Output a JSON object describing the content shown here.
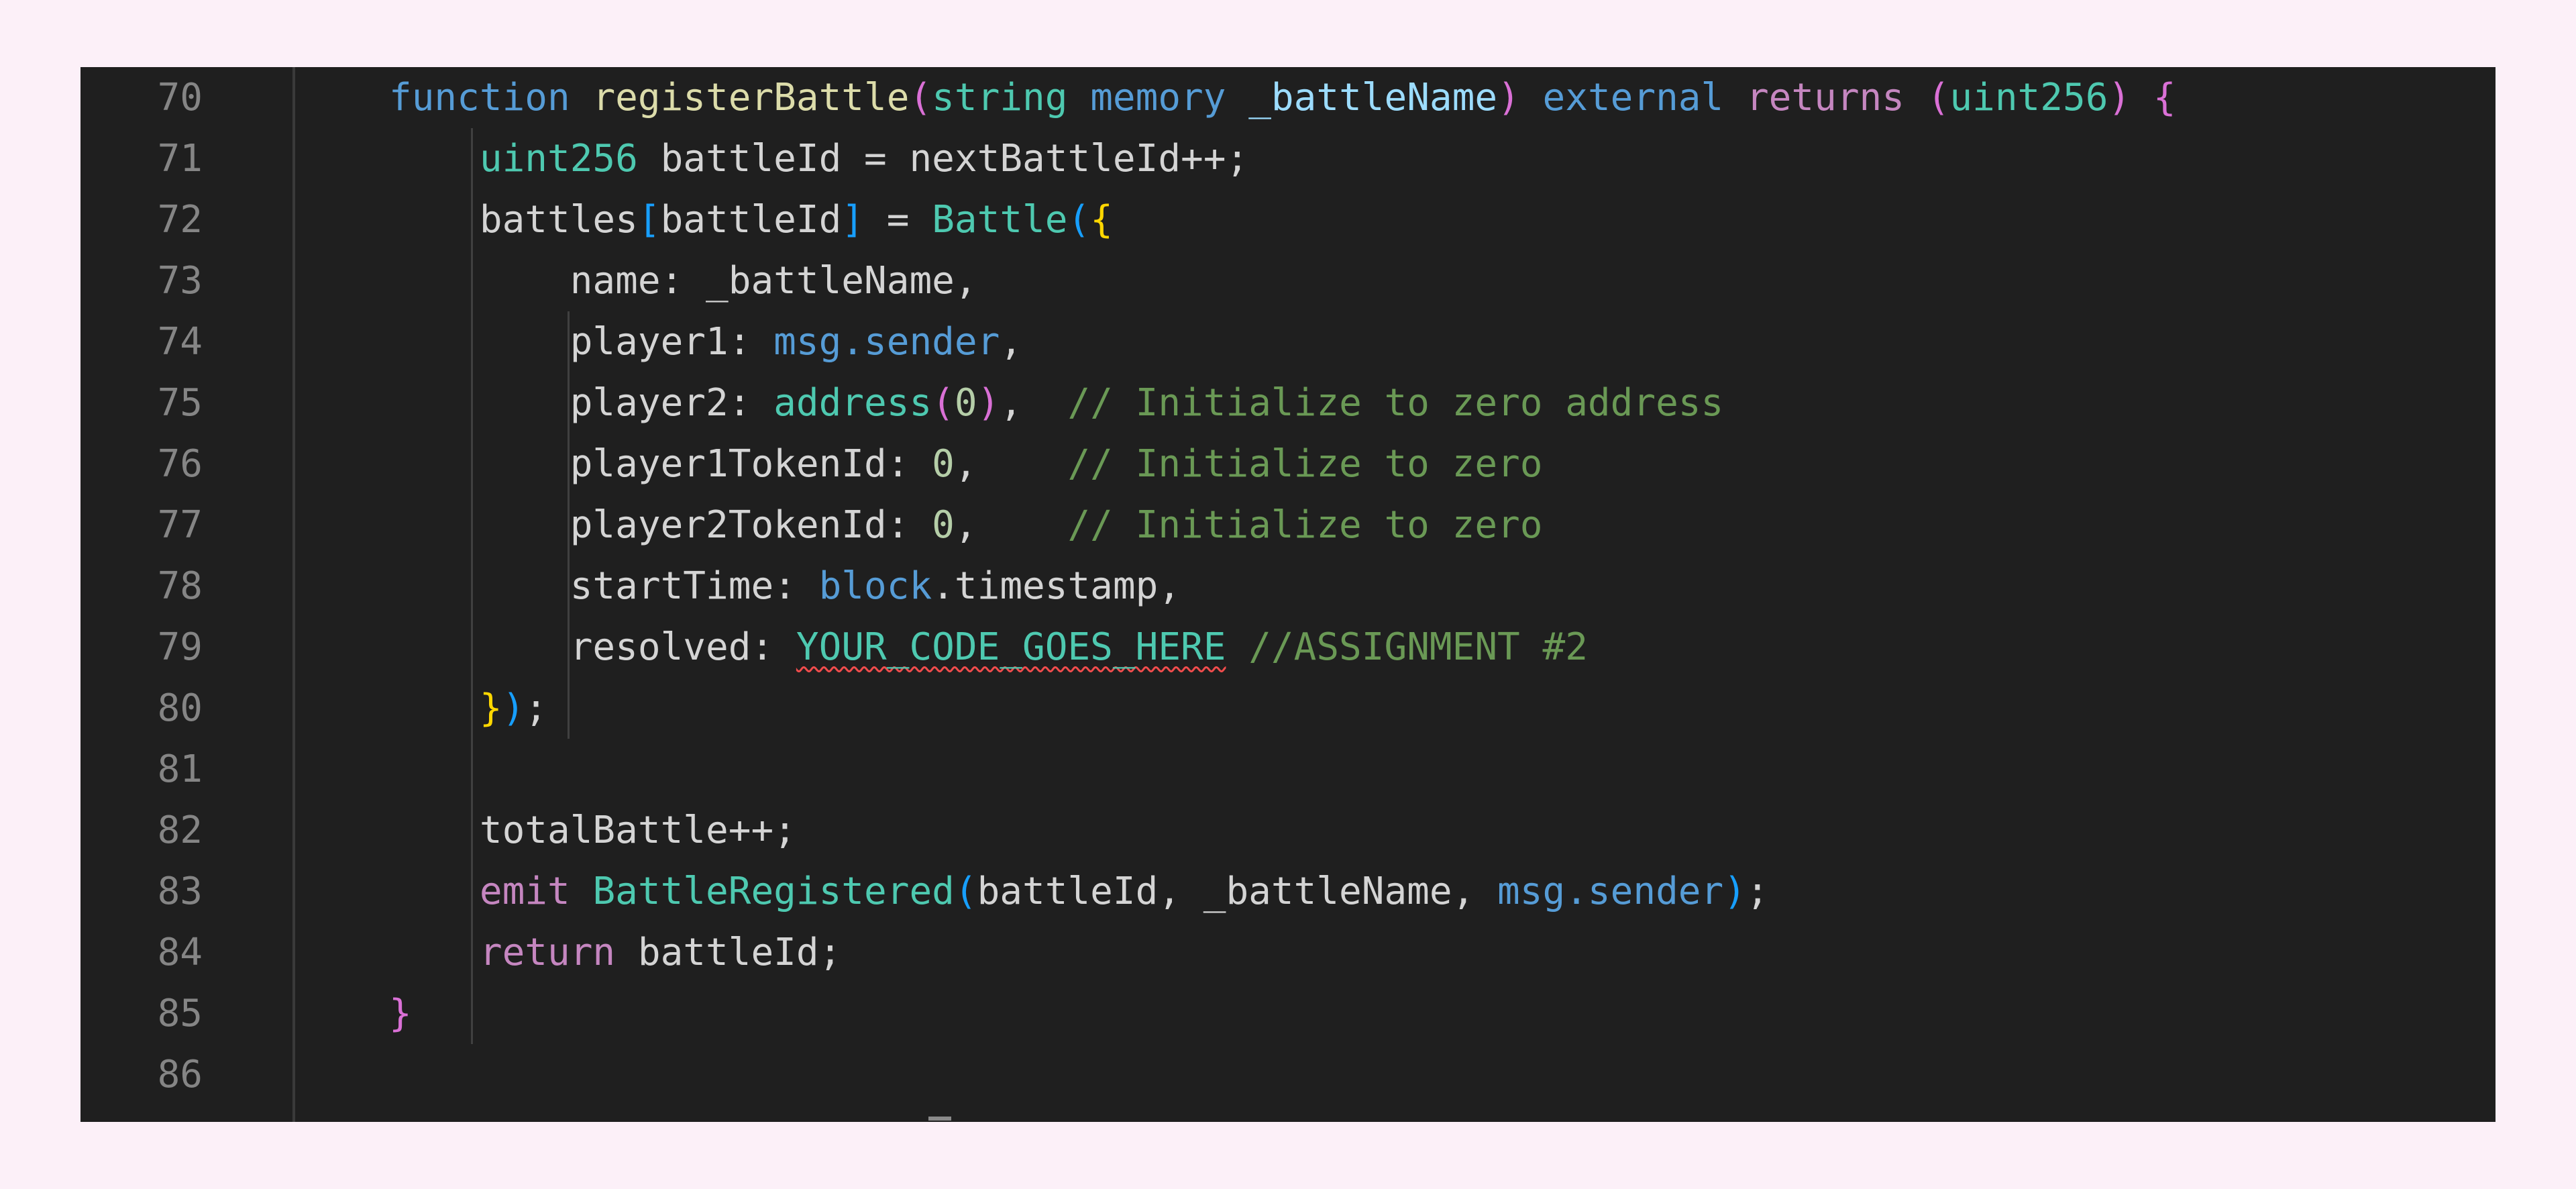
{
  "editor": {
    "line_numbers": [
      "70",
      "71",
      "72",
      "73",
      "74",
      "75",
      "76",
      "77",
      "78",
      "79",
      "80",
      "81",
      "82",
      "83",
      "84",
      "85",
      "86"
    ],
    "tokens": {
      "t_function": "function",
      "t_registerBattle": "registerBattle",
      "t_lparen": "(",
      "t_string": "string",
      "t_memory": "memory",
      "t_battleNameParam": "_battleName",
      "t_rparen": ")",
      "t_external": "external",
      "t_returns": "returns",
      "t_returns_paren_open": "(",
      "t_uint256_ret": "uint256",
      "t_returns_paren_close": ")",
      "t_open_brace": "{",
      "t_uint256": "uint256",
      "t_battleId_decl": "battleId = nextBattleId++;",
      "t_battles": "battles",
      "t_lbracket": "[",
      "t_battleId_idx": "battleId",
      "t_rbracket": "]",
      "t_assign": " = ",
      "t_Battle": "Battle",
      "t_battle_lparen": "(",
      "t_battle_lbrace": "{",
      "t_name_field": "name: _battleName,",
      "t_player1_key": "player1: ",
      "t_msg": "msg",
      "t_dot_sender": ".sender",
      "t_comma": ",",
      "t_player2_key": "player2: ",
      "t_address": "address",
      "t_addr_lparen": "(",
      "t_zero": "0",
      "t_addr_rparen": ")",
      "t_comma_spaces": ",  ",
      "t_cmt_zero_address": "// Initialize to zero address",
      "t_player1TokenId_key": "player1TokenId: ",
      "t_player2TokenId_key": "player2TokenId: ",
      "t_comma_pad": ",    ",
      "t_cmt_zero": "// Initialize to zero",
      "t_startTime_key": "startTime: ",
      "t_block": "block",
      "t_timestamp": ".timestamp,",
      "t_resolved_key": "resolved: ",
      "t_placeholder": "YOUR_CODE_GOES_HERE",
      "t_cmt_assignment": "//ASSIGNMENT #2",
      "t_close_brace_y": "}",
      "t_close_paren_b": ")",
      "t_semicolon": ";",
      "t_totalBattle": "totalBattle++;",
      "t_emit": "emit",
      "t_BattleRegistered": "BattleRegistered",
      "t_emit_lparen": "(",
      "t_emit_args": "battleId, _battleName, ",
      "t_emit_rparen": ")",
      "t_return": "return",
      "t_return_val": " battleId;",
      "t_close_fn": "}"
    }
  }
}
